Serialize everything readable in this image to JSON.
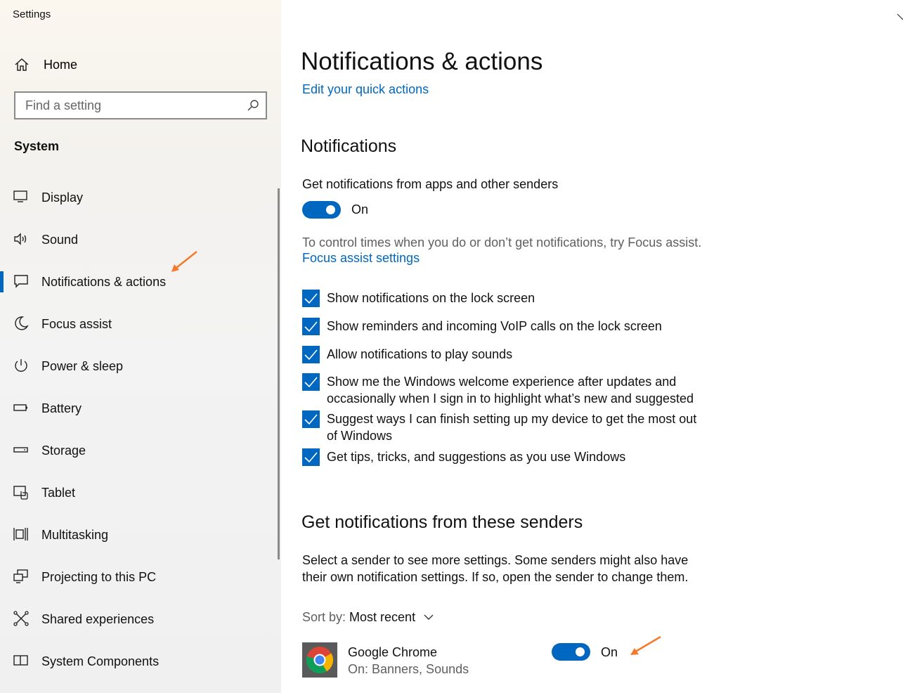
{
  "window": {
    "title": "Settings"
  },
  "sidebar": {
    "home_label": "Home",
    "search_placeholder": "Find a setting",
    "section_label": "System",
    "items": [
      {
        "label": "Display",
        "icon": "monitor-icon"
      },
      {
        "label": "Sound",
        "icon": "speaker-icon"
      },
      {
        "label": "Notifications & actions",
        "icon": "notification-icon",
        "active": true
      },
      {
        "label": "Focus assist",
        "icon": "moon-icon"
      },
      {
        "label": "Power & sleep",
        "icon": "power-icon"
      },
      {
        "label": "Battery",
        "icon": "battery-icon"
      },
      {
        "label": "Storage",
        "icon": "storage-icon"
      },
      {
        "label": "Tablet",
        "icon": "tablet-icon"
      },
      {
        "label": "Multitasking",
        "icon": "multitasking-icon"
      },
      {
        "label": "Projecting to this PC",
        "icon": "projecting-icon"
      },
      {
        "label": "Shared experiences",
        "icon": "shared-experiences-icon"
      },
      {
        "label": "System Components",
        "icon": "system-components-icon"
      }
    ]
  },
  "main": {
    "title": "Notifications & actions",
    "quick_actions_link": "Edit your quick actions",
    "notifications_heading": "Notifications",
    "get_notifications_label": "Get notifications from apps and other senders",
    "get_notifications_state": "On",
    "focus_hint": "To control times when you do or don’t get notifications, try Focus assist.",
    "focus_link": "Focus assist settings",
    "checkboxes": [
      {
        "label": "Show notifications on the lock screen",
        "checked": true
      },
      {
        "label": "Show reminders and incoming VoIP calls on the lock screen",
        "checked": true
      },
      {
        "label": "Allow notifications to play sounds",
        "checked": true
      },
      {
        "label": "Show me the Windows welcome experience after updates and occasionally when I sign in to highlight what’s new and suggested",
        "checked": true
      },
      {
        "label": "Suggest ways I can finish setting up my device to get the most out of Windows",
        "checked": true
      },
      {
        "label": "Get tips, tricks, and suggestions as you use Windows",
        "checked": true
      }
    ],
    "senders_heading": "Get notifications from these senders",
    "senders_description": "Select a sender to see more settings. Some senders might also have their own notification settings. If so, open the sender to change them.",
    "sort_by_label": "Sort by:",
    "sort_by_value": "Most recent",
    "senders": [
      {
        "name": "Google Chrome",
        "detail": "On: Banners, Sounds",
        "state": "On",
        "icon": "chrome-icon"
      }
    ]
  },
  "colors": {
    "accent": "#0067c0",
    "annotation_arrow": "#f5792a"
  }
}
